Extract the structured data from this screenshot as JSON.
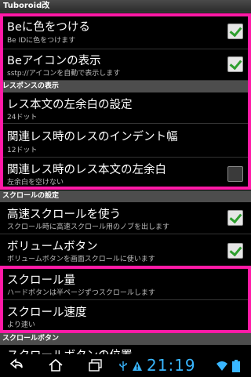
{
  "app": {
    "title": "Tuboroid改"
  },
  "items1": [
    {
      "title": "Beに色をつける",
      "summary": "Be IDに色をつけます",
      "checked": true
    },
    {
      "title": "Beアイコンの表示",
      "summary": "sstp://アイコンを自動で表示します",
      "checked": true
    }
  ],
  "section_res": "レスポンスの表示",
  "items2": [
    {
      "title": "レス本文の左余白の設定",
      "summary": "24ドット"
    },
    {
      "title": "関連レス時のレスのインデント幅",
      "summary": "12ドット"
    },
    {
      "title": "関連レス時のレス本文の左余白",
      "summary": "左余白を空けない",
      "checked": false
    }
  ],
  "section_scroll": "スクロールの設定",
  "items3": [
    {
      "title": "高速スクロールを使う",
      "summary": "スクロール時に高速スクロール用のノブを出します",
      "checked": true
    },
    {
      "title": "ボリュームボタン",
      "summary": "ボリュームボタンを画面スクロールに使います",
      "checked": true
    },
    {
      "title": "スクロール量",
      "summary": "ハードボタンは半ページずつスクロールします"
    },
    {
      "title": "スクロール速度",
      "summary": "より速い"
    }
  ],
  "section_scrollbtn": "スクロールボタン",
  "items4": [
    {
      "title": "スクロールボタンの位置"
    }
  ],
  "status": {
    "time": "21:19"
  },
  "colors": {
    "highlight": "#ff1aa6",
    "check": "#2e9e2e",
    "clock": "#39b6ff"
  },
  "icons": [
    "back-icon",
    "home-icon",
    "recent-apps-icon",
    "usb-icon",
    "warning-icon",
    "wifi-icon",
    "battery-icon"
  ]
}
